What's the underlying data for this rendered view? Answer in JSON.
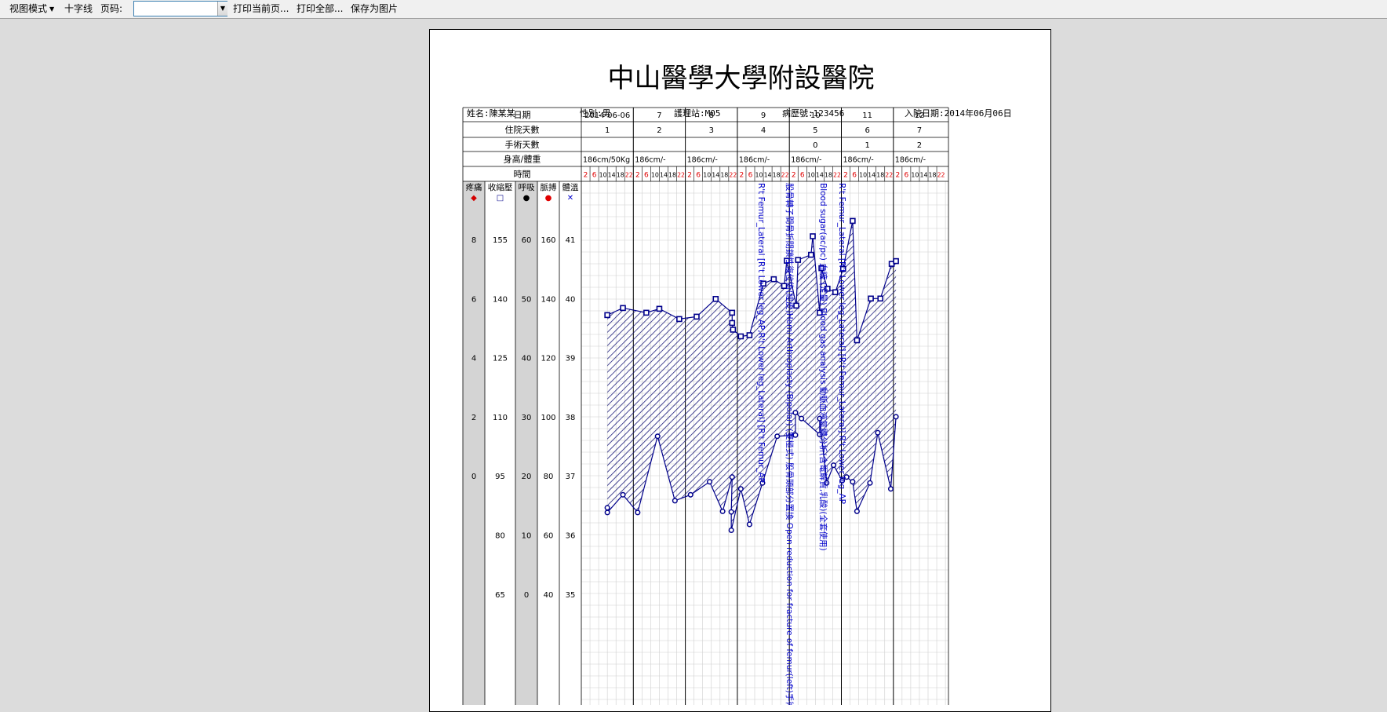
{
  "toolbar": {
    "view_mode": "视图模式",
    "crosshair": "十字线",
    "page_label": "页码:",
    "page_value": "",
    "print_current": "打印当前页...",
    "print_all": "打印全部...",
    "save_image": "保存为图片"
  },
  "sheet": {
    "title": "中山醫學大學附設醫院",
    "patient": {
      "name": "姓名:陳某某",
      "gender": "性別:男",
      "station": "護理站:M05",
      "record_no": "病歷號:123456",
      "admit_date": "入院日期:2014年06月06日"
    },
    "row_labels": [
      "日期",
      "住院天數",
      "手術天數",
      "身高/體重",
      "時間"
    ],
    "days": [
      {
        "date": "2014-06-06",
        "stay": "1",
        "op": "",
        "hw": "186cm/50Kg"
      },
      {
        "date": "7",
        "stay": "2",
        "op": "",
        "hw": "186cm/-"
      },
      {
        "date": "8",
        "stay": "3",
        "op": "",
        "hw": "186cm/-"
      },
      {
        "date": "9",
        "stay": "4",
        "op": "",
        "hw": "186cm/-"
      },
      {
        "date": "10",
        "stay": "5",
        "op": "0",
        "hw": "186cm/-"
      },
      {
        "date": "11",
        "stay": "6",
        "op": "1",
        "hw": "186cm/-"
      },
      {
        "date": "12",
        "stay": "7",
        "op": "2",
        "hw": "186cm/-"
      }
    ],
    "hours": [
      "2",
      "6",
      "10",
      "14",
      "18",
      "22"
    ],
    "scale_columns": [
      {
        "name": "疼痛",
        "symbol": "◆",
        "color": "#d40000",
        "ticks": [
          "8",
          "6",
          "4",
          "2",
          "0"
        ]
      },
      {
        "name": "收縮壓",
        "symbol": "□",
        "color": "#00008b",
        "ticks": [
          "155",
          "140",
          "125",
          "110",
          "95",
          "80",
          "65"
        ]
      },
      {
        "name": "呼吸",
        "symbol": "●",
        "color": "#000000",
        "ticks": [
          "60",
          "50",
          "40",
          "30",
          "20",
          "10",
          "0"
        ]
      },
      {
        "name": "脈搏",
        "symbol": "●",
        "color": "#e00000",
        "ticks": [
          "160",
          "140",
          "120",
          "100",
          "80",
          "60",
          "40"
        ]
      },
      {
        "name": "體溫",
        "symbol": "✕",
        "color": "#0000cc",
        "ticks": [
          "41",
          "40",
          "39",
          "38",
          "37",
          "36",
          "35"
        ]
      }
    ],
    "annotations": [
      "R't Femur_Lateral [R't Lower leg_AP,R't Lower leg_Lateral] [R't Femur_AP",
      "股骨轉子間骨折閉鎖性復位術(經皮)Hemi Arthroplasty (Bipolar) (雙極式) 股骨頭部分置換 Open reduction for fracture of femur(left)手術",
      "Blood sugar(ac/pc) 血糖 (定量) Blood gas analysis 動脈血液氣體分析(含電解質,乳酸)(全套使用)",
      "R't Femur_Lateral [R't Lower leg_Lateral] [R't Femur_Lateral] R't Lower leg_AP"
    ]
  },
  "chart_data": {
    "type": "line",
    "title": "",
    "xlabel": "時間",
    "ylabel": "收縮壓",
    "ylim": [
      65,
      155
    ],
    "grid": true,
    "x_days": [
      "2014-06-06",
      "7",
      "8",
      "9",
      "10",
      "11",
      "12"
    ],
    "series": [
      {
        "name": "收縮壓",
        "marker": "square",
        "color": "#00008b",
        "points": [
          {
            "t": 3.0,
            "v": 135.8
          },
          {
            "t": 4.8,
            "v": 137.6
          },
          {
            "t": 7.5,
            "v": 136.4
          },
          {
            "t": 9.0,
            "v": 137.4
          },
          {
            "t": 11.3,
            "v": 134.8
          },
          {
            "t": 13.3,
            "v": 135.4
          },
          {
            "t": 15.5,
            "v": 139.9
          },
          {
            "t": 17.4,
            "v": 136.4
          },
          {
            "t": 17.4,
            "v": 133.8
          },
          {
            "t": 17.5,
            "v": 132.1
          },
          {
            "t": 18.4,
            "v": 130.4
          },
          {
            "t": 19.4,
            "v": 130.7
          },
          {
            "t": 21.0,
            "v": 143.8
          },
          {
            "t": 22.2,
            "v": 144.9
          },
          {
            "t": 23.4,
            "v": 143.2
          },
          {
            "t": 23.7,
            "v": 149.6
          },
          {
            "t": 24.8,
            "v": 138.2
          },
          {
            "t": 25.0,
            "v": 149.8
          },
          {
            "t": 26.5,
            "v": 151.1
          },
          {
            "t": 26.7,
            "v": 155.8
          },
          {
            "t": 27.5,
            "v": 136.4
          },
          {
            "t": 27.7,
            "v": 147.7
          },
          {
            "t": 28.4,
            "v": 142.5
          },
          {
            "t": 29.3,
            "v": 141.6
          },
          {
            "t": 30.2,
            "v": 147.5
          },
          {
            "t": 31.3,
            "v": 159.7
          },
          {
            "t": 31.8,
            "v": 129.4
          },
          {
            "t": 33.4,
            "v": 140.0
          },
          {
            "t": 34.5,
            "v": 140.0
          },
          {
            "t": 35.8,
            "v": 148.8
          },
          {
            "t": 36.3,
            "v": 149.5
          }
        ]
      },
      {
        "name": "呼吸",
        "marker": "circle",
        "color": "#00008b",
        "points": [
          {
            "t": 3.0,
            "v": 14.6
          },
          {
            "t": 3.0,
            "v": 13.8
          },
          {
            "t": 4.8,
            "v": 16.8
          },
          {
            "t": 6.5,
            "v": 13.8
          },
          {
            "t": 8.8,
            "v": 26.7
          },
          {
            "t": 10.8,
            "v": 15.8
          },
          {
            "t": 12.6,
            "v": 16.8
          },
          {
            "t": 14.8,
            "v": 19.0
          },
          {
            "t": 16.3,
            "v": 14.0
          },
          {
            "t": 17.4,
            "v": 19.8
          },
          {
            "t": 17.3,
            "v": 13.9
          },
          {
            "t": 17.3,
            "v": 10.8
          },
          {
            "t": 18.4,
            "v": 17.8
          },
          {
            "t": 19.4,
            "v": 11.8
          },
          {
            "t": 20.9,
            "v": 18.8
          },
          {
            "t": 22.6,
            "v": 26.7
          },
          {
            "t": 24.7,
            "v": 26.9
          },
          {
            "t": 24.7,
            "v": 30.7
          },
          {
            "t": 25.4,
            "v": 29.7
          },
          {
            "t": 27.5,
            "v": 27.0
          },
          {
            "t": 27.5,
            "v": 29.7
          },
          {
            "t": 28.3,
            "v": 18.8
          },
          {
            "t": 29.1,
            "v": 21.8
          },
          {
            "t": 30.1,
            "v": 19.2
          },
          {
            "t": 30.6,
            "v": 19.8
          },
          {
            "t": 31.3,
            "v": 19.0
          },
          {
            "t": 31.8,
            "v": 14.0
          },
          {
            "t": 33.3,
            "v": 18.8
          },
          {
            "t": 34.2,
            "v": 27.3
          },
          {
            "t": 35.7,
            "v": 17.8
          },
          {
            "t": 36.3,
            "v": 30.0
          }
        ]
      }
    ]
  }
}
